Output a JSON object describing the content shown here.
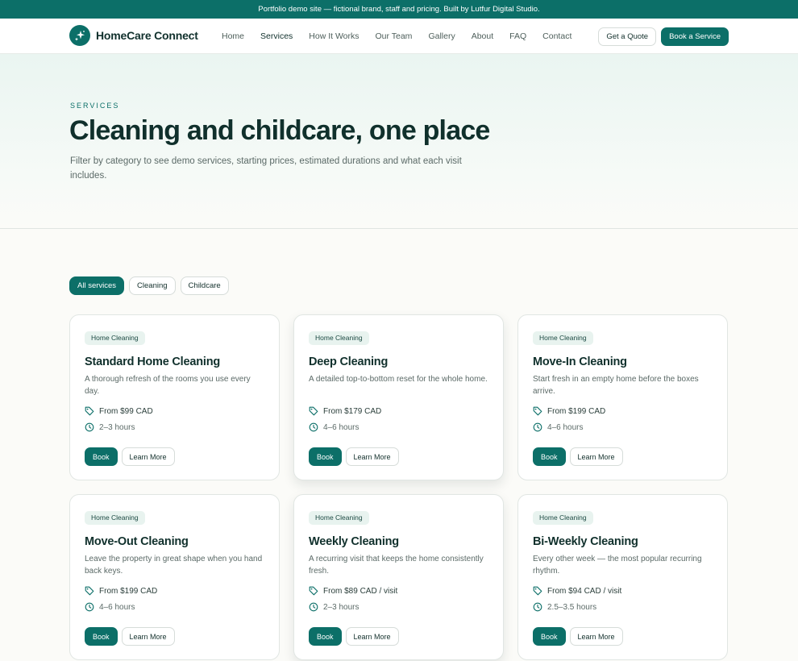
{
  "banner": {
    "text": "Portfolio demo site — fictional brand, staff and pricing. Built by Lutfur Digital Studio."
  },
  "header": {
    "brand": "HomeCare Connect",
    "nav": [
      "Home",
      "Services",
      "How It Works",
      "Our Team",
      "Gallery",
      "About",
      "FAQ",
      "Contact"
    ],
    "active_nav": "Services",
    "quote_label": "Get a Quote",
    "book_label": "Book a Service"
  },
  "hero": {
    "eyebrow": "SERVICES",
    "title": "Cleaning and childcare, one place",
    "subtitle": "Filter by category to see demo services, starting prices, estimated durations and what each visit includes."
  },
  "filters": {
    "items": [
      "All services",
      "Cleaning",
      "Childcare"
    ],
    "active": "All services"
  },
  "cards": [
    {
      "tag": "Home Cleaning",
      "title": "Standard Home Cleaning",
      "desc": "A thorough refresh of the rooms you use every day.",
      "price": "From $99 CAD",
      "duration": "2–3 hours",
      "book": "Book",
      "more": "Learn More"
    },
    {
      "tag": "Home Cleaning",
      "title": "Deep Cleaning",
      "desc": "A detailed top-to-bottom reset for the whole home.",
      "price": "From $179 CAD",
      "duration": "4–6 hours",
      "book": "Book",
      "more": "Learn More"
    },
    {
      "tag": "Home Cleaning",
      "title": "Move-In Cleaning",
      "desc": "Start fresh in an empty home before the boxes arrive.",
      "price": "From $199 CAD",
      "duration": "4–6 hours",
      "book": "Book",
      "more": "Learn More"
    },
    {
      "tag": "Home Cleaning",
      "title": "Move-Out Cleaning",
      "desc": "Leave the property in great shape when you hand back keys.",
      "price": "From $199 CAD",
      "duration": "4–6 hours",
      "book": "Book",
      "more": "Learn More"
    },
    {
      "tag": "Home Cleaning",
      "title": "Weekly Cleaning",
      "desc": "A recurring visit that keeps the home consistently fresh.",
      "price": "From $89 CAD / visit",
      "duration": "2–3 hours",
      "book": "Book",
      "more": "Learn More"
    },
    {
      "tag": "Home Cleaning",
      "title": "Bi-Weekly Cleaning",
      "desc": "Every other week — the most popular recurring rhythm.",
      "price": "From $94 CAD / visit",
      "duration": "2.5–3.5 hours",
      "book": "Book",
      "more": "Learn More"
    }
  ],
  "theme": {
    "primary": "#0c6f68",
    "text": "#10302c",
    "muted": "#5b6a67",
    "tag_bg": "#e8f3ef"
  },
  "icons": {
    "brand": "sparkle-icon",
    "price": "price-tag-icon",
    "duration": "clock-icon"
  }
}
